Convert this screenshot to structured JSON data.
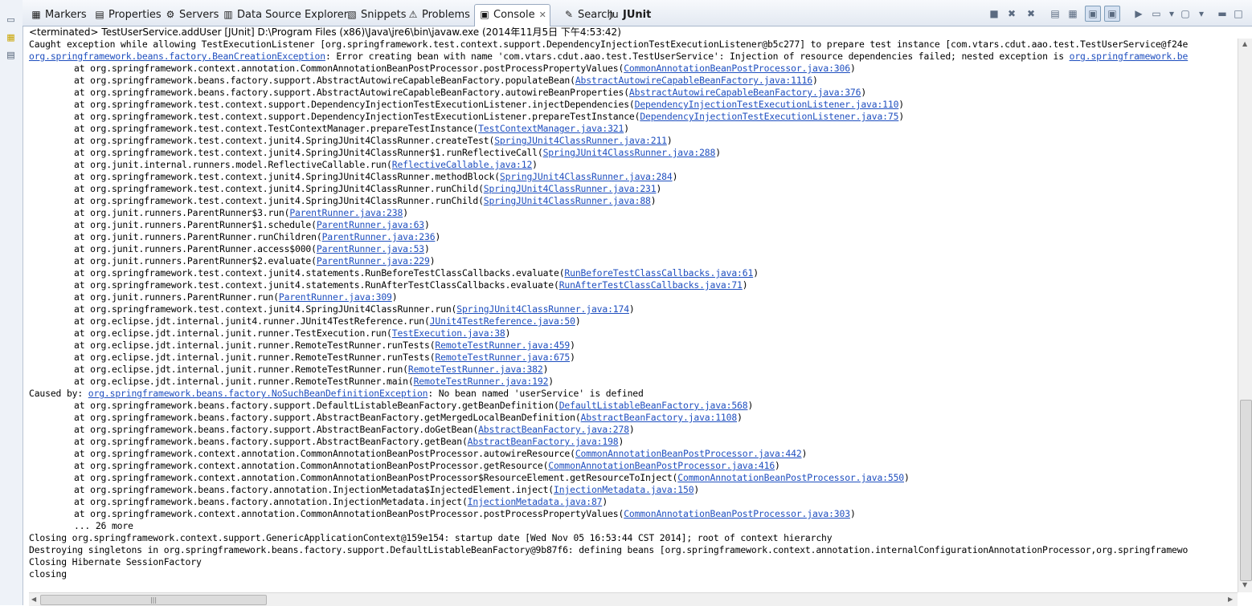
{
  "tabs": [
    {
      "label": "Markers",
      "icon": "markers-icon",
      "glyph": "▦"
    },
    {
      "label": "Properties",
      "icon": "properties-icon",
      "glyph": "▤"
    },
    {
      "label": "Servers",
      "icon": "servers-icon",
      "glyph": "⚙"
    },
    {
      "label": "Data Source Explorer",
      "icon": "data-source-icon",
      "glyph": "▥"
    },
    {
      "label": "Snippets",
      "icon": "snippets-icon",
      "glyph": "▧"
    },
    {
      "label": "Problems",
      "icon": "problems-icon",
      "glyph": "⚠"
    },
    {
      "label": "Console",
      "icon": "console-icon",
      "glyph": "▣",
      "close": "✕"
    },
    {
      "label": "Search",
      "icon": "search-icon",
      "glyph": "✎"
    },
    {
      "label": "JUnit",
      "icon": "junit-icon",
      "glyph": "Ju"
    }
  ],
  "toolbar": [
    {
      "name": "terminate-icon",
      "glyph": "■"
    },
    {
      "name": "remove-launch-icon",
      "glyph": "✖"
    },
    {
      "name": "remove-all-icon",
      "glyph": "✖"
    },
    {
      "name": "scroll-lock-icon",
      "glyph": "▤"
    },
    {
      "name": "clear-console-icon",
      "glyph": "▦"
    },
    {
      "name": "show-stdout-icon",
      "glyph": "▣",
      "pressed": true
    },
    {
      "name": "show-stderr-icon",
      "glyph": "▣",
      "pressed": true
    },
    {
      "name": "pin-console-icon",
      "glyph": "▶"
    },
    {
      "name": "display-console-icon",
      "glyph": "▭"
    },
    {
      "name": "dropdown-icon",
      "glyph": "▾"
    },
    {
      "name": "open-console-icon",
      "glyph": "▢"
    },
    {
      "name": "dropdown-icon",
      "glyph": "▾"
    },
    {
      "name": "minimize-icon",
      "glyph": "▬"
    },
    {
      "name": "maximize-icon",
      "glyph": "□"
    }
  ],
  "process_label": "<terminated> TestUserService.addUser [JUnit] D:\\Program Files (x86)\\Java\\jre6\\bin\\javaw.exe (2014年11月5日 下午4:53:42)",
  "console_lines": [
    [
      {
        "t": "Caught exception while allowing TestExecutionListener [org.springframework.test.context.support.DependencyInjectionTestExecutionListener@b5c277] to prepare test instance [com.vtars.cdut.aao.test.TestUserService@f24e"
      }
    ],
    [
      {
        "t": "org.springframework.beans.factory.BeanCreationException",
        "l": 1
      },
      {
        "t": ": Error creating bean with name 'com.vtars.cdut.aao.test.TestUserService': Injection of resource dependencies failed; nested exception is "
      },
      {
        "t": "org.springframework.be",
        "l": 1
      }
    ],
    [
      {
        "t": "\tat org.springframework.context.annotation.CommonAnnotationBeanPostProcessor.postProcessPropertyValues("
      },
      {
        "t": "CommonAnnotationBeanPostProcessor.java:306",
        "l": 1
      },
      {
        "t": ")"
      }
    ],
    [
      {
        "t": "\tat org.springframework.beans.factory.support.AbstractAutowireCapableBeanFactory.populateBean("
      },
      {
        "t": "AbstractAutowireCapableBeanFactory.java:1116",
        "l": 1
      },
      {
        "t": ")"
      }
    ],
    [
      {
        "t": "\tat org.springframework.beans.factory.support.AbstractAutowireCapableBeanFactory.autowireBeanProperties("
      },
      {
        "t": "AbstractAutowireCapableBeanFactory.java:376",
        "l": 1
      },
      {
        "t": ")"
      }
    ],
    [
      {
        "t": "\tat org.springframework.test.context.support.DependencyInjectionTestExecutionListener.injectDependencies("
      },
      {
        "t": "DependencyInjectionTestExecutionListener.java:110",
        "l": 1
      },
      {
        "t": ")"
      }
    ],
    [
      {
        "t": "\tat org.springframework.test.context.support.DependencyInjectionTestExecutionListener.prepareTestInstance("
      },
      {
        "t": "DependencyInjectionTestExecutionListener.java:75",
        "l": 1
      },
      {
        "t": ")"
      }
    ],
    [
      {
        "t": "\tat org.springframework.test.context.TestContextManager.prepareTestInstance("
      },
      {
        "t": "TestContextManager.java:321",
        "l": 1
      },
      {
        "t": ")"
      }
    ],
    [
      {
        "t": "\tat org.springframework.test.context.junit4.SpringJUnit4ClassRunner.createTest("
      },
      {
        "t": "SpringJUnit4ClassRunner.java:211",
        "l": 1
      },
      {
        "t": ")"
      }
    ],
    [
      {
        "t": "\tat org.springframework.test.context.junit4.SpringJUnit4ClassRunner$1.runReflectiveCall("
      },
      {
        "t": "SpringJUnit4ClassRunner.java:288",
        "l": 1
      },
      {
        "t": ")"
      }
    ],
    [
      {
        "t": "\tat org.junit.internal.runners.model.ReflectiveCallable.run("
      },
      {
        "t": "ReflectiveCallable.java:12",
        "l": 1
      },
      {
        "t": ")"
      }
    ],
    [
      {
        "t": "\tat org.springframework.test.context.junit4.SpringJUnit4ClassRunner.methodBlock("
      },
      {
        "t": "SpringJUnit4ClassRunner.java:284",
        "l": 1
      },
      {
        "t": ")"
      }
    ],
    [
      {
        "t": "\tat org.springframework.test.context.junit4.SpringJUnit4ClassRunner.runChild("
      },
      {
        "t": "SpringJUnit4ClassRunner.java:231",
        "l": 1
      },
      {
        "t": ")"
      }
    ],
    [
      {
        "t": "\tat org.springframework.test.context.junit4.SpringJUnit4ClassRunner.runChild("
      },
      {
        "t": "SpringJUnit4ClassRunner.java:88",
        "l": 1
      },
      {
        "t": ")"
      }
    ],
    [
      {
        "t": "\tat org.junit.runners.ParentRunner$3.run("
      },
      {
        "t": "ParentRunner.java:238",
        "l": 1
      },
      {
        "t": ")"
      }
    ],
    [
      {
        "t": "\tat org.junit.runners.ParentRunner$1.schedule("
      },
      {
        "t": "ParentRunner.java:63",
        "l": 1
      },
      {
        "t": ")"
      }
    ],
    [
      {
        "t": "\tat org.junit.runners.ParentRunner.runChildren("
      },
      {
        "t": "ParentRunner.java:236",
        "l": 1
      },
      {
        "t": ")"
      }
    ],
    [
      {
        "t": "\tat org.junit.runners.ParentRunner.access$000("
      },
      {
        "t": "ParentRunner.java:53",
        "l": 1
      },
      {
        "t": ")"
      }
    ],
    [
      {
        "t": "\tat org.junit.runners.ParentRunner$2.evaluate("
      },
      {
        "t": "ParentRunner.java:229",
        "l": 1
      },
      {
        "t": ")"
      }
    ],
    [
      {
        "t": "\tat org.springframework.test.context.junit4.statements.RunBeforeTestClassCallbacks.evaluate("
      },
      {
        "t": "RunBeforeTestClassCallbacks.java:61",
        "l": 1
      },
      {
        "t": ")"
      }
    ],
    [
      {
        "t": "\tat org.springframework.test.context.junit4.statements.RunAfterTestClassCallbacks.evaluate("
      },
      {
        "t": "RunAfterTestClassCallbacks.java:71",
        "l": 1
      },
      {
        "t": ")"
      }
    ],
    [
      {
        "t": "\tat org.junit.runners.ParentRunner.run("
      },
      {
        "t": "ParentRunner.java:309",
        "l": 1
      },
      {
        "t": ")"
      }
    ],
    [
      {
        "t": "\tat org.springframework.test.context.junit4.SpringJUnit4ClassRunner.run("
      },
      {
        "t": "SpringJUnit4ClassRunner.java:174",
        "l": 1
      },
      {
        "t": ")"
      }
    ],
    [
      {
        "t": "\tat org.eclipse.jdt.internal.junit4.runner.JUnit4TestReference.run("
      },
      {
        "t": "JUnit4TestReference.java:50",
        "l": 1
      },
      {
        "t": ")"
      }
    ],
    [
      {
        "t": "\tat org.eclipse.jdt.internal.junit.runner.TestExecution.run("
      },
      {
        "t": "TestExecution.java:38",
        "l": 1
      },
      {
        "t": ")"
      }
    ],
    [
      {
        "t": "\tat org.eclipse.jdt.internal.junit.runner.RemoteTestRunner.runTests("
      },
      {
        "t": "RemoteTestRunner.java:459",
        "l": 1
      },
      {
        "t": ")"
      }
    ],
    [
      {
        "t": "\tat org.eclipse.jdt.internal.junit.runner.RemoteTestRunner.runTests("
      },
      {
        "t": "RemoteTestRunner.java:675",
        "l": 1
      },
      {
        "t": ")"
      }
    ],
    [
      {
        "t": "\tat org.eclipse.jdt.internal.junit.runner.RemoteTestRunner.run("
      },
      {
        "t": "RemoteTestRunner.java:382",
        "l": 1
      },
      {
        "t": ")"
      }
    ],
    [
      {
        "t": "\tat org.eclipse.jdt.internal.junit.runner.RemoteTestRunner.main("
      },
      {
        "t": "RemoteTestRunner.java:192",
        "l": 1
      },
      {
        "t": ")"
      }
    ],
    [
      {
        "t": "Caused by: "
      },
      {
        "t": "org.springframework.beans.factory.NoSuchBeanDefinitionException",
        "l": 1
      },
      {
        "t": ": No bean named 'userService' is defined"
      }
    ],
    [
      {
        "t": "\tat org.springframework.beans.factory.support.DefaultListableBeanFactory.getBeanDefinition("
      },
      {
        "t": "DefaultListableBeanFactory.java:568",
        "l": 1
      },
      {
        "t": ")"
      }
    ],
    [
      {
        "t": "\tat org.springframework.beans.factory.support.AbstractBeanFactory.getMergedLocalBeanDefinition("
      },
      {
        "t": "AbstractBeanFactory.java:1108",
        "l": 1
      },
      {
        "t": ")"
      }
    ],
    [
      {
        "t": "\tat org.springframework.beans.factory.support.AbstractBeanFactory.doGetBean("
      },
      {
        "t": "AbstractBeanFactory.java:278",
        "l": 1
      },
      {
        "t": ")"
      }
    ],
    [
      {
        "t": "\tat org.springframework.beans.factory.support.AbstractBeanFactory.getBean("
      },
      {
        "t": "AbstractBeanFactory.java:198",
        "l": 1
      },
      {
        "t": ")"
      }
    ],
    [
      {
        "t": "\tat org.springframework.context.annotation.CommonAnnotationBeanPostProcessor.autowireResource("
      },
      {
        "t": "CommonAnnotationBeanPostProcessor.java:442",
        "l": 1
      },
      {
        "t": ")"
      }
    ],
    [
      {
        "t": "\tat org.springframework.context.annotation.CommonAnnotationBeanPostProcessor.getResource("
      },
      {
        "t": "CommonAnnotationBeanPostProcessor.java:416",
        "l": 1
      },
      {
        "t": ")"
      }
    ],
    [
      {
        "t": "\tat org.springframework.context.annotation.CommonAnnotationBeanPostProcessor$ResourceElement.getResourceToInject("
      },
      {
        "t": "CommonAnnotationBeanPostProcessor.java:550",
        "l": 1
      },
      {
        "t": ")"
      }
    ],
    [
      {
        "t": "\tat org.springframework.beans.factory.annotation.InjectionMetadata$InjectedElement.inject("
      },
      {
        "t": "InjectionMetadata.java:150",
        "l": 1
      },
      {
        "t": ")"
      }
    ],
    [
      {
        "t": "\tat org.springframework.beans.factory.annotation.InjectionMetadata.inject("
      },
      {
        "t": "InjectionMetadata.java:87",
        "l": 1
      },
      {
        "t": ")"
      }
    ],
    [
      {
        "t": "\tat org.springframework.context.annotation.CommonAnnotationBeanPostProcessor.postProcessPropertyValues("
      },
      {
        "t": "CommonAnnotationBeanPostProcessor.java:303",
        "l": 1
      },
      {
        "t": ")"
      }
    ],
    [
      {
        "t": "\t... 26 more"
      }
    ],
    [
      {
        "t": "Closing org.springframework.context.support.GenericApplicationContext@159e154: startup date [Wed Nov 05 16:53:44 CST 2014]; root of context hierarchy"
      }
    ],
    [
      {
        "t": "Destroying singletons in org.springframework.beans.factory.support.DefaultListableBeanFactory@9b87f6: defining beans [org.springframework.context.annotation.internalConfigurationAnnotationProcessor,org.springframewo"
      }
    ],
    [
      {
        "t": "Closing Hibernate SessionFactory"
      }
    ],
    [
      {
        "t": "closing"
      }
    ]
  ]
}
